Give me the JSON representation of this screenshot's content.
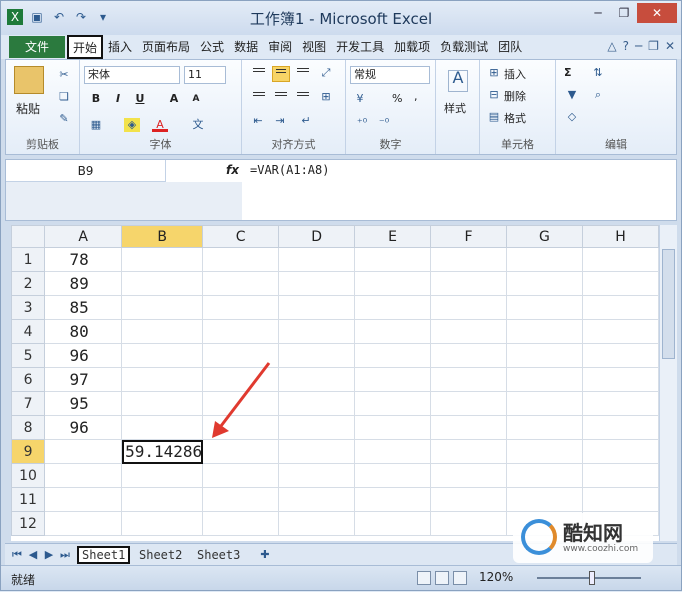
{
  "window": {
    "title": "工作簿1 - Microsoft Excel"
  },
  "tabs": {
    "file": "文件",
    "items": [
      "开始",
      "插入",
      "页面布局",
      "公式",
      "数据",
      "审阅",
      "视图",
      "开发工具",
      "加载项",
      "负载测试",
      "团队"
    ],
    "active_index": 0
  },
  "ribbon": {
    "clipboard": {
      "label": "剪贴板",
      "paste": "粘贴"
    },
    "font": {
      "label": "字体",
      "name": "宋体",
      "size": "11",
      "bold": "B",
      "italic": "I",
      "underline": "U"
    },
    "alignment": {
      "label": "对齐方式"
    },
    "number": {
      "label": "数字",
      "format": "常规",
      "percent": "%",
      "comma": ","
    },
    "styles": {
      "label": "样式"
    },
    "cells": {
      "label": "单元格",
      "insert": "插入",
      "delete": "删除",
      "format": "格式"
    },
    "editing": {
      "label": "编辑",
      "sum": "Σ"
    }
  },
  "formula_bar": {
    "name_box": "B9",
    "fx": "fx",
    "formula": "=VAR(A1:A8)"
  },
  "grid": {
    "columns": [
      "A",
      "B",
      "C",
      "D",
      "E",
      "F",
      "G",
      "H"
    ],
    "rows": [
      "1",
      "2",
      "3",
      "4",
      "5",
      "6",
      "7",
      "8",
      "9",
      "10",
      "11",
      "12"
    ],
    "col_a_values": [
      "78",
      "89",
      "85",
      "80",
      "96",
      "97",
      "95",
      "96"
    ],
    "b9_value": "59.14286",
    "active_cell": "B9"
  },
  "sheets": {
    "tabs": [
      "Sheet1",
      "Sheet2",
      "Sheet3"
    ],
    "active_index": 0
  },
  "status": {
    "ready": "就绪",
    "zoom": "120%"
  },
  "watermark": {
    "brand": "酷知网",
    "url": "www.coozhi.com"
  },
  "colors": {
    "file_tab": "#2b7a3e",
    "active_header": "#f6d56b",
    "arrow": "#e03a2f"
  }
}
